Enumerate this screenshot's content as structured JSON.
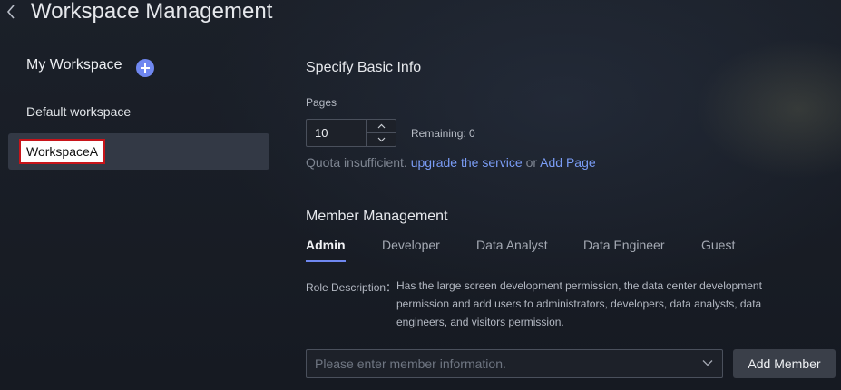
{
  "header": {
    "title": "Workspace Management",
    "back_icon": "chevron-left-icon"
  },
  "sidebar": {
    "title": "My Workspace",
    "add_icon": "plus-icon",
    "accent_color": "#6f87f0",
    "items": [
      {
        "label": "Default workspace"
      },
      {
        "label": "WorkspaceA",
        "selected": true,
        "highlight_color": "#c8141a"
      }
    ]
  },
  "basic_info": {
    "title": "Specify Basic Info",
    "pages_label": "Pages",
    "pages_value": "10",
    "remaining": "Remaining: 0",
    "quota_text": "Quota insufficient.",
    "upgrade_link": "upgrade the service",
    "or_text": "or",
    "add_page_link": "Add Page"
  },
  "member_management": {
    "title": "Member Management",
    "tabs": [
      {
        "label": "Admin",
        "active": true
      },
      {
        "label": "Developer"
      },
      {
        "label": "Data Analyst"
      },
      {
        "label": "Data Engineer"
      },
      {
        "label": "Guest"
      }
    ],
    "role_description_label": "Role Description：",
    "role_description": "Has the large screen development permission, the data center development permission and add users to administrators, developers, data analysts, data engineers, and visitors permission.",
    "member_input_placeholder": "Please enter member information.",
    "add_member_label": "Add Member"
  }
}
